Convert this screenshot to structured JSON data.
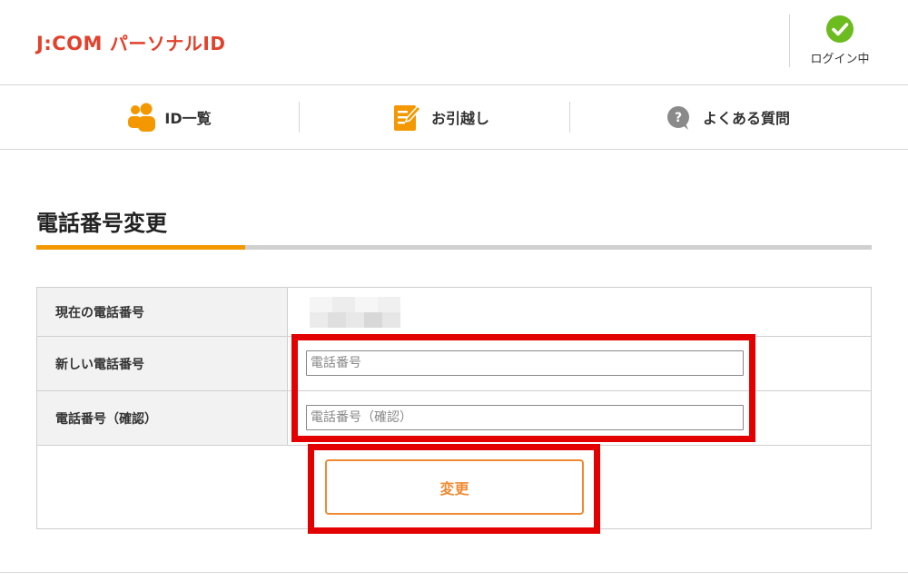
{
  "header": {
    "logo_brand": "J:COM",
    "logo_sub": "パーソナルID",
    "login_status": "ログイン中",
    "login_icon": "check-circle-icon",
    "brand_color": "#e2412c",
    "status_color": "#6cbb1f"
  },
  "nav": {
    "items": [
      {
        "label": "ID一覧",
        "icon": "users-icon"
      },
      {
        "label": "お引越し",
        "icon": "notepad-pen-icon"
      },
      {
        "label": "よくある質問",
        "icon": "help-circle-icon"
      }
    ],
    "icon_color": "#f39800"
  },
  "page": {
    "title": "電話番号変更",
    "accent_color": "#f39800"
  },
  "form": {
    "rows": [
      {
        "label": "現在の電話番号",
        "value": ""
      },
      {
        "label": "新しい電話番号",
        "placeholder": "電話番号"
      },
      {
        "label": "電話番号（確認）",
        "placeholder": "電話番号（確認）"
      }
    ],
    "submit_label": "変更",
    "button_color": "#f08a32",
    "highlight_color": "#e20000"
  }
}
